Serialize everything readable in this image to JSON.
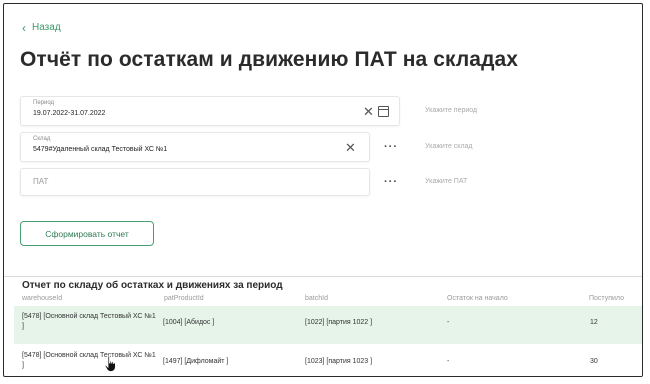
{
  "nav": {
    "back_label": "Назад"
  },
  "page": {
    "title": "Отчёт по остаткам и движению ПАТ на складах"
  },
  "form": {
    "period": {
      "label": "Период",
      "value": "19.07.2022-31.07.2022",
      "hint": "Укажите период"
    },
    "warehouse": {
      "label": "Склад",
      "value": "5479#Удаленный склад Тестовый ХС №1",
      "hint": "Укажите склад"
    },
    "pat": {
      "placeholder": "ПАТ",
      "hint": "Укажите ПАТ"
    },
    "submit_label": "Сформировать отчет"
  },
  "report": {
    "title": "Отчет по складу об остатках и движениях за период",
    "columns": [
      "warehouseId",
      "patProductId",
      "batchId",
      "Остаток на начало",
      "Поступило"
    ],
    "rows": [
      {
        "warehouse": "[5478] [Основной склад Тестовый ХС №1 ]",
        "product": "[1004] [Абидос ]",
        "batch": "[1022] [партия 1022 ]",
        "start": "-",
        "received": "12"
      },
      {
        "warehouse": "[5478] [Основной склад Тестовый ХС №1 ]",
        "product": "[1497] [Дифломайт ]",
        "batch": "[1023] [партия 1023 ]",
        "start": "-",
        "received": "30"
      }
    ]
  },
  "colors": {
    "accent": "#3a9a6a",
    "row_highlight": "#e6f4ea"
  }
}
